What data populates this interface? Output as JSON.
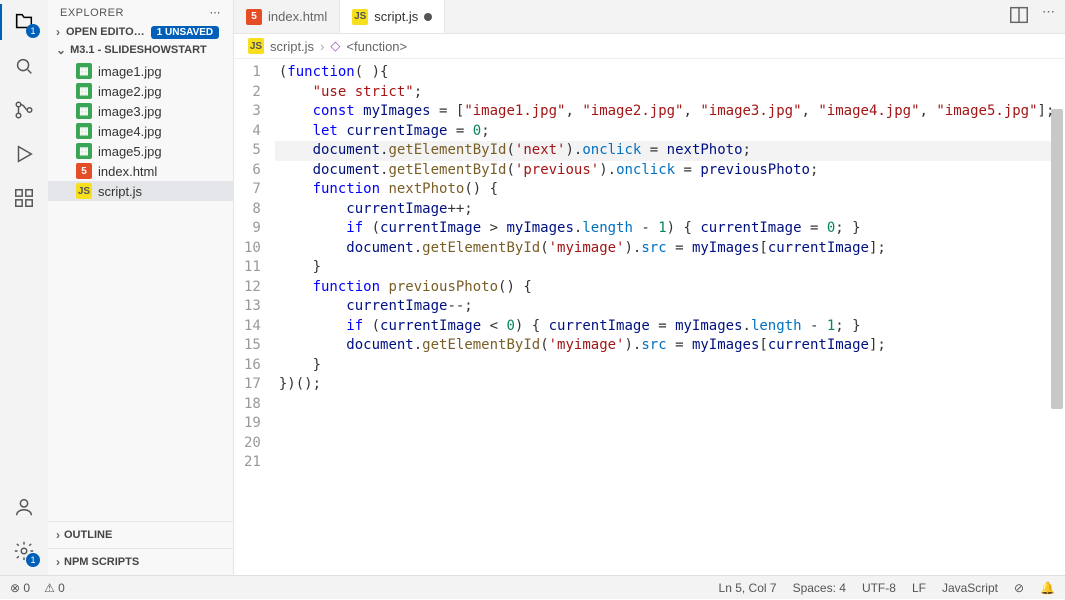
{
  "sidebar": {
    "title": "EXPLORER",
    "openEditors": {
      "label": "OPEN EDITO…",
      "badge": "1 UNSAVED"
    },
    "project": "M3.1 - SLIDESHOWSTART",
    "files": [
      {
        "name": "image1.jpg",
        "type": "img"
      },
      {
        "name": "image2.jpg",
        "type": "img"
      },
      {
        "name": "image3.jpg",
        "type": "img"
      },
      {
        "name": "image4.jpg",
        "type": "img"
      },
      {
        "name": "image5.jpg",
        "type": "img"
      },
      {
        "name": "index.html",
        "type": "html"
      },
      {
        "name": "script.js",
        "type": "js"
      }
    ],
    "outline": "OUTLINE",
    "npm": "NPM SCRIPTS"
  },
  "activity": {
    "explorerBadge": "1",
    "settingsBadge": "1"
  },
  "tabs": [
    {
      "name": "index.html",
      "type": "html",
      "active": false,
      "dirty": false
    },
    {
      "name": "script.js",
      "type": "js",
      "active": true,
      "dirty": true
    }
  ],
  "breadcrumbs": {
    "file": "script.js",
    "symbol": "<function>"
  },
  "code": {
    "lines": [
      {
        "n": 1,
        "seg": [
          [
            "(",
            "op"
          ],
          [
            "function",
            "kw"
          ],
          [
            "( ){",
            "op"
          ]
        ]
      },
      {
        "n": 2,
        "seg": [
          [
            "    ",
            ""
          ],
          [
            "\"use strict\"",
            "str"
          ],
          [
            ";",
            "op"
          ]
        ]
      },
      {
        "n": 3,
        "seg": [
          [
            "",
            ""
          ]
        ]
      },
      {
        "n": 4,
        "seg": [
          [
            "    ",
            ""
          ],
          [
            "const",
            "kw"
          ],
          [
            " ",
            ""
          ],
          [
            "myImages",
            "id"
          ],
          [
            " = [",
            "op"
          ],
          [
            "\"image1.jpg\"",
            "str"
          ],
          [
            ", ",
            "op"
          ],
          [
            "\"image2.jpg\"",
            "str"
          ],
          [
            ", ",
            "op"
          ],
          [
            "\"image3.jpg\"",
            "str"
          ],
          [
            ", ",
            "op"
          ],
          [
            "\"image4.jpg\"",
            "str"
          ],
          [
            ", ",
            "op"
          ],
          [
            "\"image5.jpg\"",
            "str"
          ],
          [
            "];",
            "op"
          ]
        ]
      },
      {
        "n": 5,
        "seg": [
          [
            "    ",
            ""
          ],
          [
            "let",
            "kw"
          ],
          [
            " ",
            ""
          ],
          [
            "currentImage",
            "id"
          ],
          [
            " = ",
            "op"
          ],
          [
            "0",
            "num"
          ],
          [
            ";",
            "op"
          ]
        ]
      },
      {
        "n": 6,
        "seg": [
          [
            "",
            ""
          ]
        ]
      },
      {
        "n": 7,
        "seg": [
          [
            "    ",
            ""
          ],
          [
            "document",
            "id"
          ],
          [
            ".",
            "op"
          ],
          [
            "getElementById",
            "fn"
          ],
          [
            "(",
            "op"
          ],
          [
            "'next'",
            "str"
          ],
          [
            ").",
            "op"
          ],
          [
            "onclick",
            "pr"
          ],
          [
            " = ",
            "op"
          ],
          [
            "nextPhoto",
            "id"
          ],
          [
            ";",
            "op"
          ]
        ]
      },
      {
        "n": 8,
        "seg": [
          [
            "    ",
            ""
          ],
          [
            "document",
            "id"
          ],
          [
            ".",
            "op"
          ],
          [
            "getElementById",
            "fn"
          ],
          [
            "(",
            "op"
          ],
          [
            "'previous'",
            "str"
          ],
          [
            ").",
            "op"
          ],
          [
            "onclick",
            "pr"
          ],
          [
            " = ",
            "op"
          ],
          [
            "previousPhoto",
            "id"
          ],
          [
            ";",
            "op"
          ]
        ]
      },
      {
        "n": 9,
        "seg": [
          [
            "",
            ""
          ]
        ]
      },
      {
        "n": 10,
        "seg": [
          [
            "    ",
            ""
          ],
          [
            "function",
            "kw"
          ],
          [
            " ",
            ""
          ],
          [
            "nextPhoto",
            "fn"
          ],
          [
            "() {",
            "op"
          ]
        ]
      },
      {
        "n": 11,
        "seg": [
          [
            "        ",
            ""
          ],
          [
            "currentImage",
            "id"
          ],
          [
            "++;",
            "op"
          ]
        ]
      },
      {
        "n": 12,
        "seg": [
          [
            "        ",
            ""
          ],
          [
            "if",
            "kw"
          ],
          [
            " (",
            "op"
          ],
          [
            "currentImage",
            "id"
          ],
          [
            " > ",
            "op"
          ],
          [
            "myImages",
            "id"
          ],
          [
            ".",
            "op"
          ],
          [
            "length",
            "pr"
          ],
          [
            " - ",
            "op"
          ],
          [
            "1",
            "num"
          ],
          [
            ") { ",
            "op"
          ],
          [
            "currentImage",
            "id"
          ],
          [
            " = ",
            "op"
          ],
          [
            "0",
            "num"
          ],
          [
            "; }",
            "op"
          ]
        ]
      },
      {
        "n": 13,
        "seg": [
          [
            "        ",
            ""
          ],
          [
            "document",
            "id"
          ],
          [
            ".",
            "op"
          ],
          [
            "getElementById",
            "fn"
          ],
          [
            "(",
            "op"
          ],
          [
            "'myimage'",
            "str"
          ],
          [
            ").",
            "op"
          ],
          [
            "src",
            "pr"
          ],
          [
            " = ",
            "op"
          ],
          [
            "myImages",
            "id"
          ],
          [
            "[",
            "op"
          ],
          [
            "currentImage",
            "id"
          ],
          [
            "];",
            "op"
          ]
        ]
      },
      {
        "n": 14,
        "seg": [
          [
            "    }",
            "op"
          ]
        ]
      },
      {
        "n": 15,
        "seg": [
          [
            "",
            ""
          ]
        ]
      },
      {
        "n": 16,
        "seg": [
          [
            "    ",
            ""
          ],
          [
            "function",
            "kw"
          ],
          [
            " ",
            ""
          ],
          [
            "previousPhoto",
            "fn"
          ],
          [
            "() {",
            "op"
          ]
        ]
      },
      {
        "n": 17,
        "seg": [
          [
            "        ",
            ""
          ],
          [
            "currentImage",
            "id"
          ],
          [
            "--;",
            "op"
          ]
        ]
      },
      {
        "n": 18,
        "seg": [
          [
            "        ",
            ""
          ],
          [
            "if",
            "kw"
          ],
          [
            " (",
            "op"
          ],
          [
            "currentImage",
            "id"
          ],
          [
            " < ",
            "op"
          ],
          [
            "0",
            "num"
          ],
          [
            ") { ",
            "op"
          ],
          [
            "currentImage",
            "id"
          ],
          [
            " = ",
            "op"
          ],
          [
            "myImages",
            "id"
          ],
          [
            ".",
            "op"
          ],
          [
            "length",
            "pr"
          ],
          [
            " - ",
            "op"
          ],
          [
            "1",
            "num"
          ],
          [
            "; }",
            "op"
          ]
        ]
      },
      {
        "n": 19,
        "seg": [
          [
            "        ",
            ""
          ],
          [
            "document",
            "id"
          ],
          [
            ".",
            "op"
          ],
          [
            "getElementById",
            "fn"
          ],
          [
            "(",
            "op"
          ],
          [
            "'myimage'",
            "str"
          ],
          [
            ").",
            "op"
          ],
          [
            "src",
            "pr"
          ],
          [
            " = ",
            "op"
          ],
          [
            "myImages",
            "id"
          ],
          [
            "[",
            "op"
          ],
          [
            "currentImage",
            "id"
          ],
          [
            "];",
            "op"
          ]
        ]
      },
      {
        "n": 20,
        "seg": [
          [
            "    }",
            "op"
          ]
        ]
      },
      {
        "n": 21,
        "seg": [
          [
            "})();",
            "op"
          ]
        ]
      }
    ],
    "highlightLine": 5
  },
  "status": {
    "errors": "0",
    "warnings": "0",
    "position": "Ln 5, Col 7",
    "spaces": "Spaces: 4",
    "encoding": "UTF-8",
    "eol": "LF",
    "lang": "JavaScript"
  }
}
